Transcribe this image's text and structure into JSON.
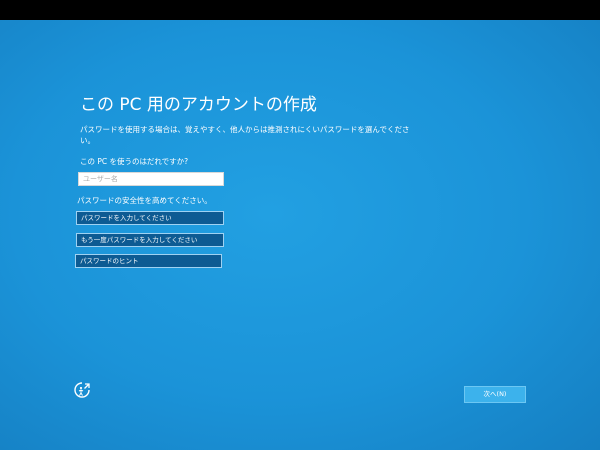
{
  "setup": {
    "title": "この PC 用のアカウントの作成",
    "description": "パスワードを使用する場合は、覚えやすく、他人からは推測されにくいパスワードを選んでください。",
    "user_question": "この PC を使うのはだれですか?",
    "username_placeholder": "ユーザー名",
    "password_heading": "パスワードの安全性を高めてください。",
    "password_placeholder": "パスワードを入力してください",
    "password_confirm_placeholder": "もう一度パスワードを入力してください",
    "hint_placeholder": "パスワードのヒント",
    "next_label": "次へ(N)"
  },
  "icons": {
    "accessibility": "ease-of-access-icon"
  },
  "colors": {
    "background": "#1b93d8",
    "field_dark": "#0d5b93",
    "next_button": "#3cb2ec"
  }
}
